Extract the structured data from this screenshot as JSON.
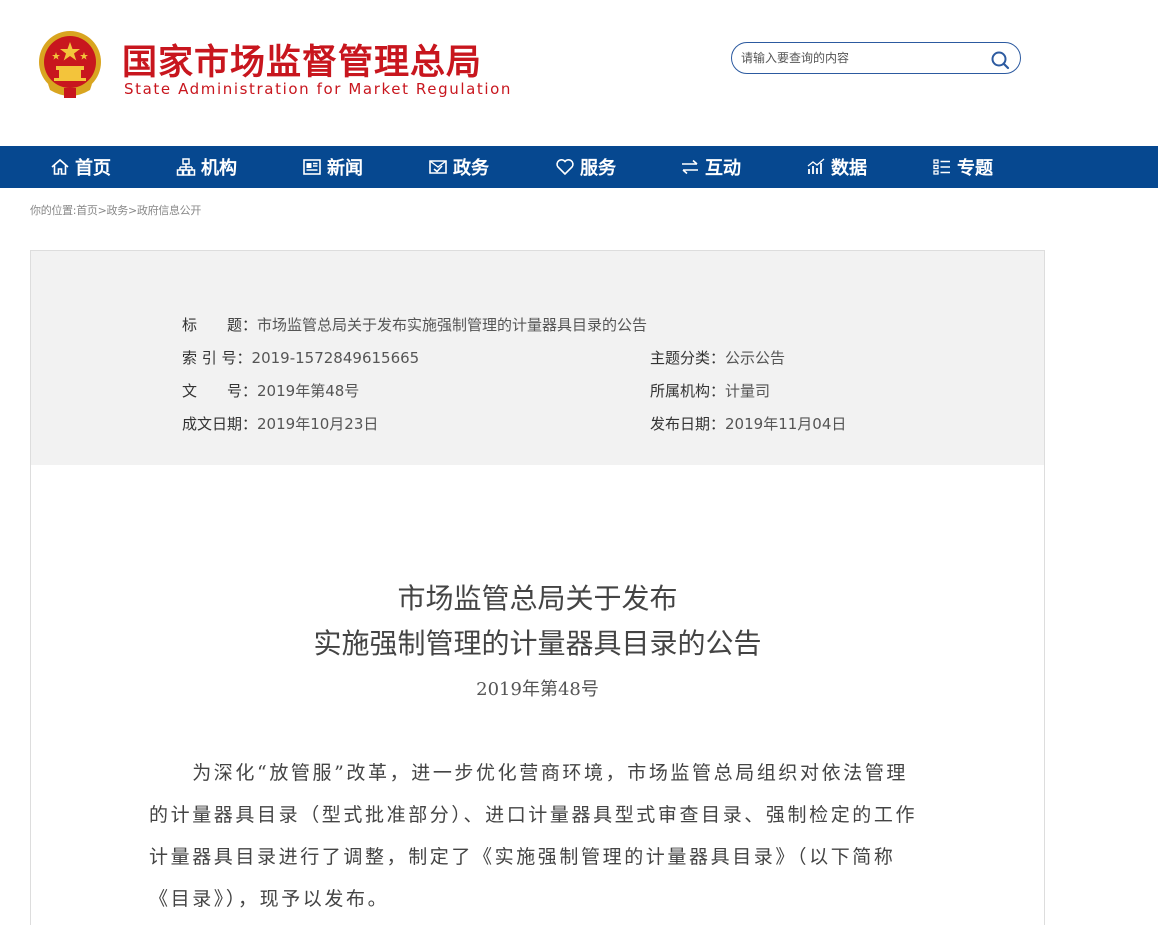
{
  "site": {
    "name_cn": "国家市场监督管理总局",
    "name_en": "State Administration for Market Regulation",
    "emblem_icon": "national-emblem-icon",
    "brand_color": "#c8161e",
    "nav_color": "#064890"
  },
  "search": {
    "placeholder": "请输入要查询的内容",
    "icon": "search-icon"
  },
  "nav": {
    "items": [
      {
        "label": "首页",
        "icon": "home-icon"
      },
      {
        "label": "机构",
        "icon": "org-chart-icon"
      },
      {
        "label": "新闻",
        "icon": "news-icon"
      },
      {
        "label": "政务",
        "icon": "affairs-icon"
      },
      {
        "label": "服务",
        "icon": "heart-icon"
      },
      {
        "label": "互动",
        "icon": "exchange-icon"
      },
      {
        "label": "数据",
        "icon": "data-chart-icon"
      },
      {
        "label": "专题",
        "icon": "topics-icon"
      }
    ]
  },
  "breadcrumb": {
    "prefix": "你的位置:",
    "items": [
      "首页",
      "政务",
      "政府信息公开"
    ],
    "separator": ">"
  },
  "meta": {
    "title_label": "标　　题：",
    "title_value": "市场监管总局关于发布实施强制管理的计量器具目录的公告",
    "index_label": "索 引 号：",
    "index_value": "2019-1572849615665",
    "category_label": "主题分类：",
    "category_value": "公示公告",
    "doc_no_label": "文　　号：",
    "doc_no_value": "2019年第48号",
    "agency_label": "所属机构：",
    "agency_value": "计量司",
    "written_date_label": "成文日期：",
    "written_date_value": "2019年10月23日",
    "publish_date_label": "发布日期：",
    "publish_date_value": "2019年11月04日"
  },
  "document": {
    "title_line1": "市场监管总局关于发布",
    "title_line2": "实施强制管理的计量器具目录的公告",
    "number": "2019年第48号",
    "body_lines": [
      "　　为深化“放管服”改革，进一步优化营商环境，市场监管总局组织对依法管理",
      "的计量器具目录（型式批准部分）、进口计量器具型式审查目录、强制检定的工作",
      "计量器具目录进行了调整，制定了《实施强制管理的计量器具目录》（以下简称",
      "《目录》），现予以发布。"
    ]
  }
}
